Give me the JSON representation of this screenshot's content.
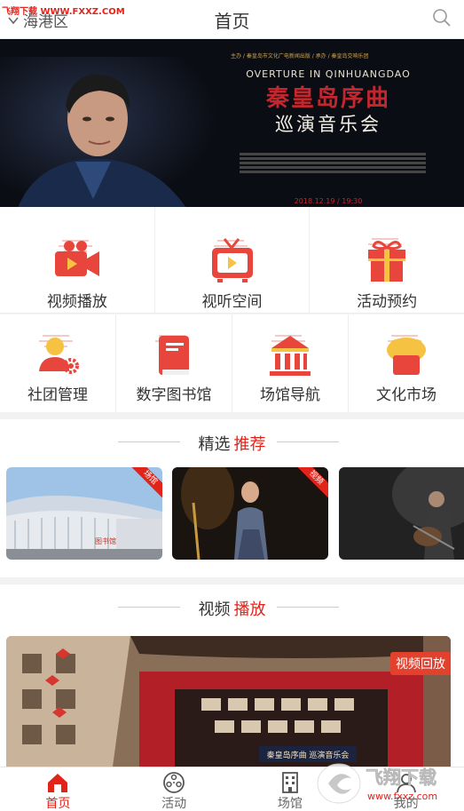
{
  "watermark_top": "飞翔下载 WWW.FXXZ.COM",
  "header": {
    "location": "海港区",
    "title": "首页"
  },
  "banner": {
    "small_text": "主办 / 秦皇岛市文化广电新闻出版 / 承办 / 秦皇岛交响乐团",
    "title_en": "OVERTURE IN QINHUANGDAO",
    "title_cn": "秦皇岛序曲",
    "subtitle_cn": "巡演音乐会",
    "date": "2018.12.19 / 19:30",
    "dots": 3,
    "active_dot": 0
  },
  "top_grid": [
    {
      "label": "视频播放",
      "icon": "video-camera-icon"
    },
    {
      "label": "视听空间",
      "icon": "tv-icon"
    },
    {
      "label": "活动预约",
      "icon": "gift-icon"
    }
  ],
  "bottom_grid": [
    {
      "label": "社团管理",
      "icon": "user-gear-icon"
    },
    {
      "label": "数字图书馆",
      "icon": "book-icon"
    },
    {
      "label": "场馆导航",
      "icon": "building-icon"
    },
    {
      "label": "文化市场",
      "icon": "cake-icon"
    }
  ],
  "featured": {
    "title_a": "精选",
    "title_b": "推荐",
    "cards": [
      {
        "tag": "场馆"
      },
      {
        "tag": "视频"
      },
      {
        "tag": ""
      }
    ]
  },
  "video_section": {
    "title_a": "视频",
    "title_b": "播放",
    "tag": "视频回放",
    "stage_text": "秦皇岛序曲 巡演音乐会"
  },
  "nav": [
    {
      "label": "首页",
      "icon": "home-icon",
      "active": true
    },
    {
      "label": "活动",
      "icon": "film-reel-icon",
      "active": false
    },
    {
      "label": "场馆",
      "icon": "building-grid-icon",
      "active": false
    },
    {
      "label": "我的",
      "icon": "user-icon",
      "active": false
    }
  ],
  "watermark_bottom": {
    "cn": "飞翔下载",
    "url": "www.fxxz.com"
  },
  "colors": {
    "accent": "#e2231a",
    "icon_red": "#e8453c",
    "icon_yellow": "#f5c242"
  }
}
